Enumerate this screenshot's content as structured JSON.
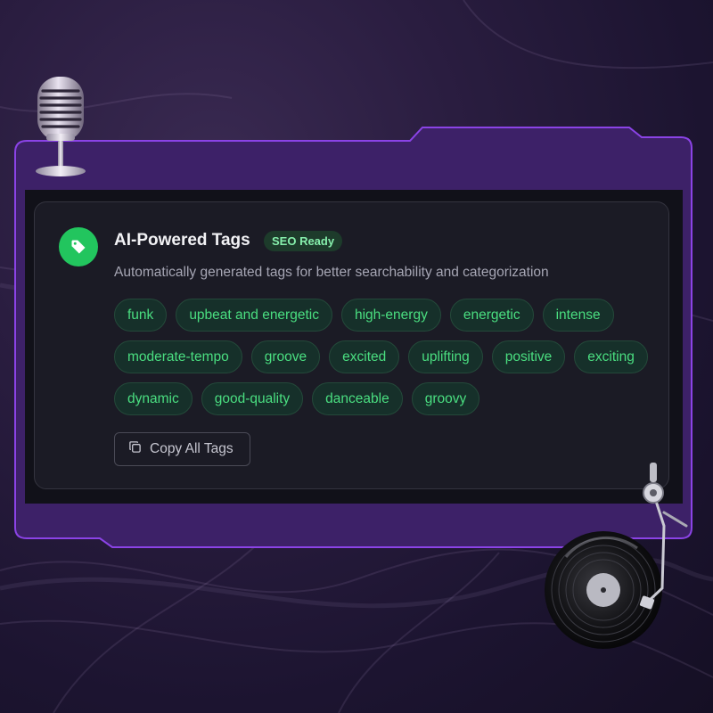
{
  "card": {
    "title": "AI-Powered Tags",
    "badge": "SEO Ready",
    "subtitle": "Automatically generated tags for better searchability and categorization",
    "tags": [
      "funk",
      "upbeat and energetic",
      "high-energy",
      "energetic",
      "intense",
      "moderate-tempo",
      "groove",
      "excited",
      "uplifting",
      "positive",
      "exciting",
      "dynamic",
      "good-quality",
      "danceable",
      "groovy"
    ],
    "copy_label": "Copy All Tags"
  },
  "icons": {
    "header": "tag-icon",
    "copy": "copy-icon",
    "decor_top": "microphone-icon",
    "decor_bottom": "turntable-icon"
  },
  "colors": {
    "accent_green": "#22c55e",
    "tag_text": "#4ade80",
    "frame_purple": "#7c3aed",
    "card_bg": "#1b1b25"
  }
}
